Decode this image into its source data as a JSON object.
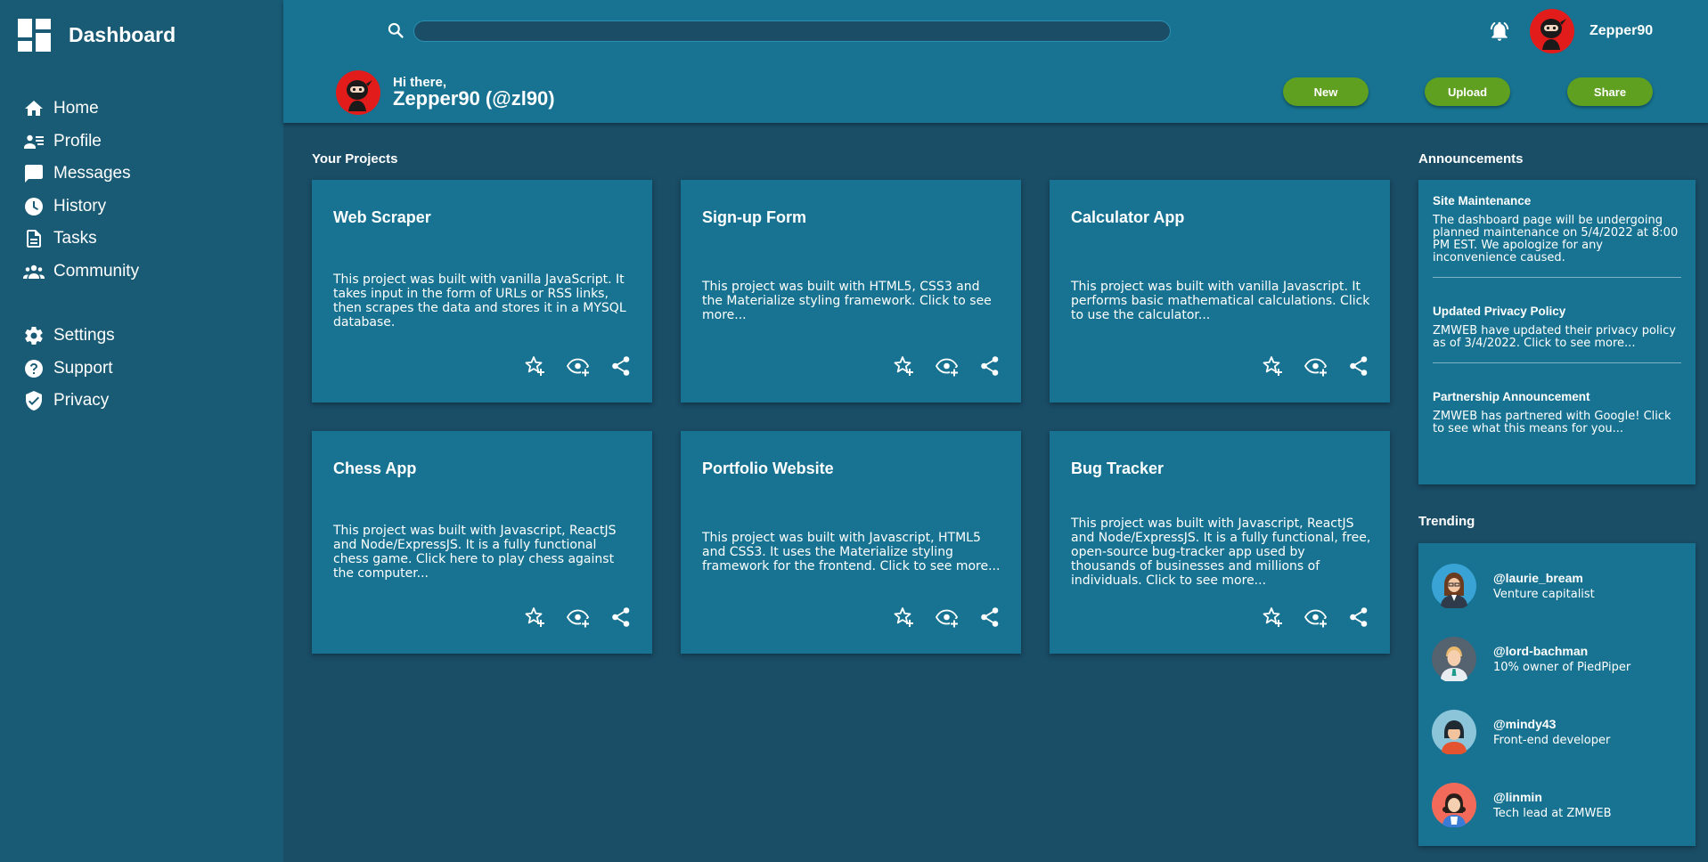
{
  "app": {
    "title": "Dashboard"
  },
  "sidebar": {
    "items": [
      {
        "label": "Home",
        "icon": "home-icon"
      },
      {
        "label": "Profile",
        "icon": "profile-icon"
      },
      {
        "label": "Messages",
        "icon": "messages-icon"
      },
      {
        "label": "History",
        "icon": "history-icon"
      },
      {
        "label": "Tasks",
        "icon": "tasks-icon"
      },
      {
        "label": "Community",
        "icon": "community-icon"
      },
      {
        "label": "Settings",
        "icon": "gear-icon"
      },
      {
        "label": "Support",
        "icon": "help-icon"
      },
      {
        "label": "Privacy",
        "icon": "shield-icon"
      }
    ]
  },
  "header": {
    "search_value": "",
    "username": "Zepper90",
    "greeting": "Hi there,",
    "display_name": "Zepper90 (@zl90)",
    "buttons": {
      "new": "New",
      "upload": "Upload",
      "share": "Share"
    }
  },
  "projects": {
    "title": "Your Projects",
    "cards": [
      {
        "title": "Web Scraper",
        "description": "This project was built with vanilla JavaScript. It takes input in the form of URLs or RSS links, then scrapes the data and stores it in a MYSQL database."
      },
      {
        "title": "Sign-up Form",
        "description": "This project was built with HTML5, CSS3 and the Materialize styling framework. Click to see more..."
      },
      {
        "title": "Calculator App",
        "description": "This project was built with vanilla Javascript. It performs basic mathematical calculations. Click to use the calculator..."
      },
      {
        "title": "Chess App",
        "description": "This project was built with Javascript, ReactJS and Node/ExpressJS. It is a fully functional chess game. Click here to play chess against the computer..."
      },
      {
        "title": "Portfolio Website",
        "description": "This project was built with Javascript, HTML5 and CSS3. It uses the Materialize styling framework for the frontend. Click to see more..."
      },
      {
        "title": "Bug Tracker",
        "description": "This project was built with Javascript, ReactJS and Node/ExpressJS. It is a fully functional, free, open-source bug-tracker app used by thousands of businesses and millions of individuals. Click to see more..."
      }
    ]
  },
  "announcements": {
    "title": "Announcements",
    "items": [
      {
        "title": "Site Maintenance",
        "body": "The dashboard page will be undergoing planned maintenance on 5/4/2022 at 8:00 PM EST. We apologize for any inconvenience caused."
      },
      {
        "title": "Updated Privacy Policy",
        "body": "ZMWEB have updated their privacy policy as of 3/4/2022. Click to see more..."
      },
      {
        "title": "Partnership Announcement",
        "body": "ZMWEB has partnered with Google! Click to see what this means for you..."
      }
    ]
  },
  "trending": {
    "title": "Trending",
    "users": [
      {
        "handle": "@laurie_bream",
        "role": "Venture capitalist"
      },
      {
        "handle": "@lord-bachman",
        "role": "10% owner of PiedPiper"
      },
      {
        "handle": "@mindy43",
        "role": "Front-end developer"
      },
      {
        "handle": "@linmin",
        "role": "Tech lead at ZMWEB"
      }
    ]
  },
  "colors": {
    "page_bg": "#1a4d66",
    "sidebar_bg": "#195a74",
    "surface": "#177391",
    "accent_green": "#5fa021",
    "avatar_red": "#e21b1b"
  }
}
